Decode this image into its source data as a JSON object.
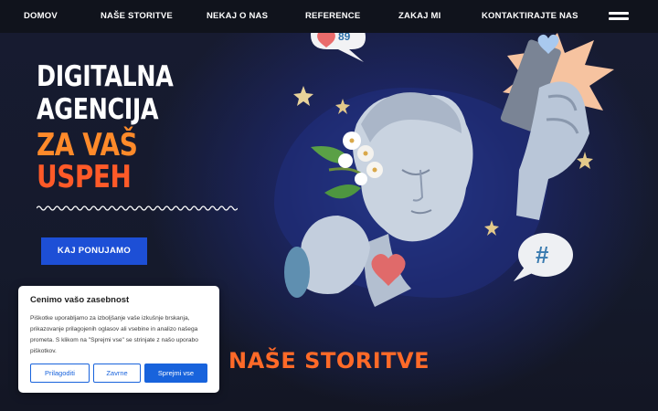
{
  "nav": {
    "items": [
      "DOMOV",
      "NAŠE STORITVE",
      "NEKAJ O NAS",
      "REFERENCE",
      "ZAKAJ MI",
      "KONTAKTIRAJTE NAS"
    ],
    "menu_icon": "hamburger-menu-icon"
  },
  "hero": {
    "title_line1": "DIGITALNA",
    "title_line2": "AGENCIJA",
    "title_line3": "ZA VAŠ",
    "title_line4": "USPEH",
    "cta_label": "KAJ PONUJAMO",
    "like_count": "89",
    "hashtag": "#"
  },
  "section": {
    "title": "NAŠE STORITVE"
  },
  "cookie": {
    "title": "Cenimo vašo zasebnost",
    "text": "Piškotke uporabljamo za izboljšanje vaše izkušnje brskanja, prikazovanje prilagojenih oglasov ali vsebine in analizo našega prometa. S klikom na \"Sprejmi vse\" se strinjate z našo uporabo piškotkov.",
    "customize_label": "Prilagoditi",
    "reject_label": "Zavrne",
    "accept_label": "Sprejmi vse"
  },
  "colors": {
    "nav_bg": "#10131c",
    "hero_bg": "#151a2c",
    "accent_orange": "#ff6a28",
    "cta_blue": "#1d4fd6",
    "cookie_blue": "#1863dc"
  }
}
